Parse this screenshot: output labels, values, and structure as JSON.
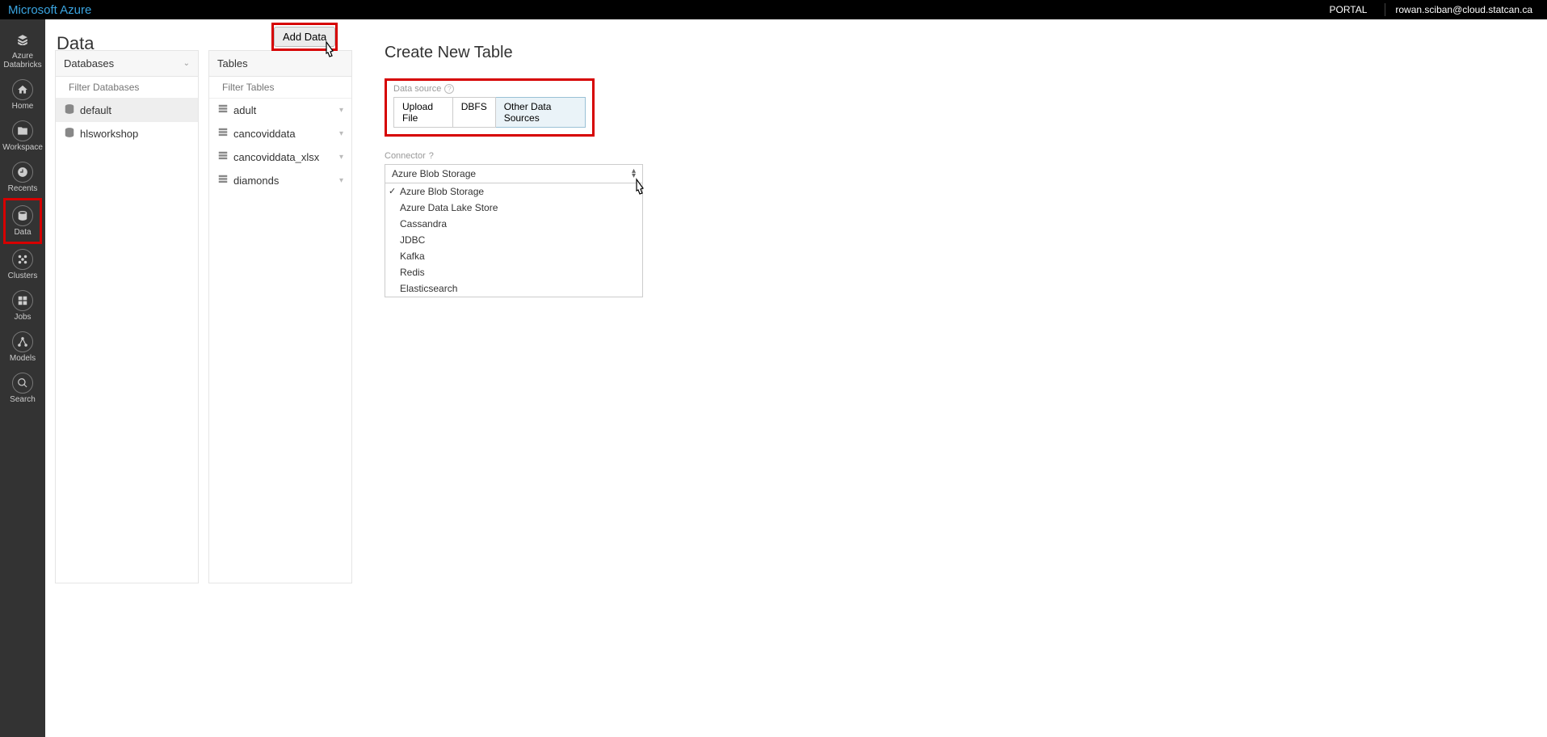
{
  "topbar": {
    "brand": "Microsoft Azure",
    "portal": "PORTAL",
    "user": "rowan.sciban@cloud.statcan.ca"
  },
  "leftnav": {
    "items": [
      {
        "label": "Azure Databricks",
        "icon": "layers-icon"
      },
      {
        "label": "Home",
        "icon": "home-icon"
      },
      {
        "label": "Workspace",
        "icon": "folder-icon"
      },
      {
        "label": "Recents",
        "icon": "clock-icon"
      },
      {
        "label": "Data",
        "icon": "database-icon",
        "highlighted": true
      },
      {
        "label": "Clusters",
        "icon": "cluster-icon"
      },
      {
        "label": "Jobs",
        "icon": "grid-icon"
      },
      {
        "label": "Models",
        "icon": "graph-icon"
      },
      {
        "label": "Search",
        "icon": "search-icon"
      }
    ]
  },
  "page_title": "Data",
  "add_data_label": "Add Data",
  "databases_panel": {
    "title": "Databases",
    "filter_placeholder": "Filter Databases",
    "items": [
      {
        "name": "default",
        "selected": true
      },
      {
        "name": "hlsworkshop"
      }
    ]
  },
  "tables_panel": {
    "title": "Tables",
    "filter_placeholder": "Filter Tables",
    "items": [
      {
        "name": "adult"
      },
      {
        "name": "cancoviddata"
      },
      {
        "name": "cancoviddata_xlsx"
      },
      {
        "name": "diamonds"
      }
    ]
  },
  "right": {
    "title": "Create New Table",
    "ds_label": "Data source",
    "ds_tabs": [
      {
        "label": "Upload File"
      },
      {
        "label": "DBFS"
      },
      {
        "label": "Other Data Sources",
        "active": true
      }
    ],
    "connector_label": "Connector",
    "connector_selected": "Azure Blob Storage",
    "connector_options": [
      "Azure Blob Storage",
      "Azure Data Lake Store",
      "Cassandra",
      "JDBC",
      "Kafka",
      "Redis",
      "Elasticsearch"
    ]
  }
}
